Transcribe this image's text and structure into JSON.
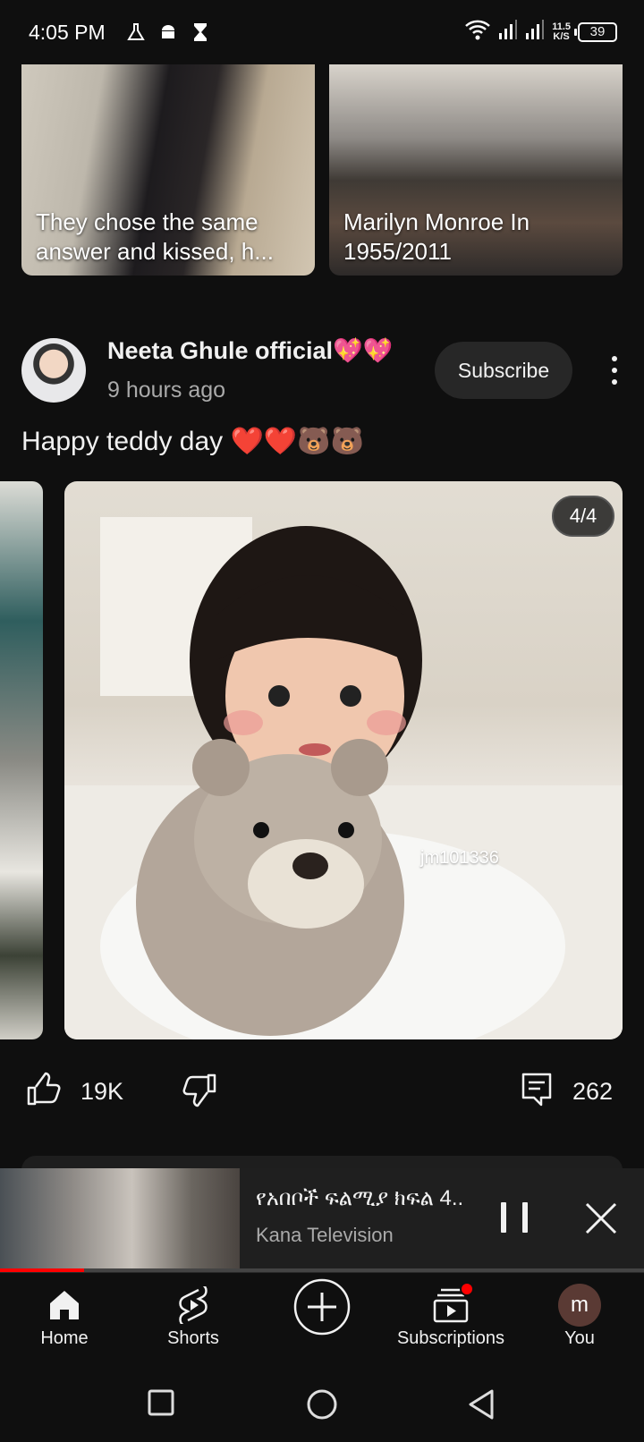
{
  "status_bar": {
    "time": "4:05 PM",
    "left_icons": [
      "flask-icon",
      "android-icon",
      "hourglass-icon"
    ],
    "net_speed_value": "11.5",
    "net_speed_unit": "K/S",
    "battery": "39"
  },
  "top_videos": [
    {
      "title": "They chose the same answer and kissed, h..."
    },
    {
      "title": "Marilyn Monroe In 1955/2011"
    }
  ],
  "post": {
    "channel_name": "Neeta Ghule official💖💖",
    "time_ago": "9 hours ago",
    "subscribe_label": "Subscribe",
    "text": "Happy teddy day ❤️❤️🐻🐻",
    "image_counter": "4/4",
    "watermark": "jm101336",
    "likes": "19K",
    "comments": "262"
  },
  "mini_player": {
    "title": "የአበቦች ፍልሚያ  ክፍል 4..",
    "channel": "Kana Television",
    "progress": 0.13
  },
  "bottom_nav": {
    "items": [
      {
        "label": "Home",
        "icon": "home-icon"
      },
      {
        "label": "Shorts",
        "icon": "shorts-icon"
      },
      {
        "label": "",
        "icon": "create-icon"
      },
      {
        "label": "Subscriptions",
        "icon": "subscriptions-icon"
      },
      {
        "label": "You",
        "icon": "avatar"
      }
    ],
    "you_initial": "m"
  },
  "colors": {
    "background": "#0f0f0f",
    "accent_red": "#ff0000",
    "secondary_text": "#aaaaaa"
  }
}
